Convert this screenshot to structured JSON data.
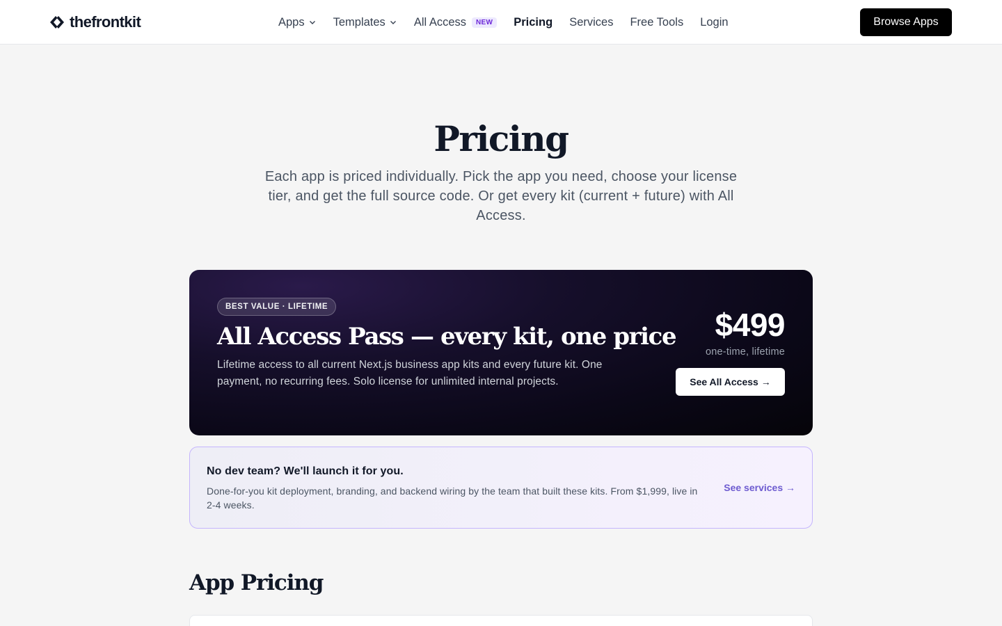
{
  "header": {
    "logo_text": "thefrontkit",
    "nav": [
      {
        "label": "Apps",
        "has_chevron": true
      },
      {
        "label": "Templates",
        "has_chevron": true
      },
      {
        "label": "All Access",
        "badge": "NEW"
      },
      {
        "label": "Pricing",
        "active": true
      },
      {
        "label": "Services"
      },
      {
        "label": "Free Tools"
      },
      {
        "label": "Login"
      }
    ],
    "cta_label": "Browse Apps"
  },
  "hero": {
    "title": "Pricing",
    "subtitle": "Each app is priced individually. Pick the app you need, choose your license tier, and get the full source code. Or get every kit (current + future) with All Access."
  },
  "all_access": {
    "badge": "BEST VALUE · LIFETIME",
    "title": "All Access Pass — every kit, one price",
    "description": "Lifetime access to all current Next.js business app kits and every future kit. One payment, no recurring fees. Solo license for unlimited internal projects.",
    "price": "$499",
    "price_note": "one-time, lifetime",
    "cta_label": "See All Access →"
  },
  "services_banner": {
    "title": "No dev team? We'll launch it for you.",
    "description": "Done-for-you kit deployment, branding, and backend wiring by the team that built these kits. From $1,999, live in 2-4 weeks.",
    "link_label": "See services →"
  },
  "app_pricing": {
    "title": "App Pricing"
  },
  "colors": {
    "accent_purple": "#6d5bd0",
    "badge_new_bg": "#ede9fe",
    "dark_card": "#0b0818"
  }
}
